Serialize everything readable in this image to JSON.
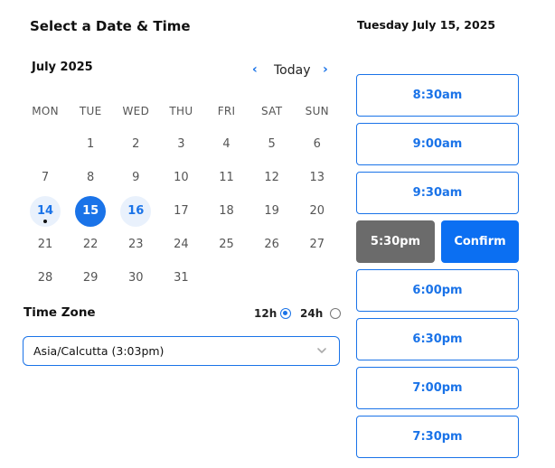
{
  "title": "Select a Date & Time",
  "selected_date_label": "Tuesday July 15, 2025",
  "calendar": {
    "month_label": "July 2025",
    "today_label": "Today",
    "prev_glyph": "‹",
    "next_glyph": "›",
    "weekdays": [
      "MON",
      "TUE",
      "WED",
      "THU",
      "FRI",
      "SAT",
      "SUN"
    ],
    "weeks": [
      [
        "",
        "1",
        "2",
        "3",
        "4",
        "5",
        "6"
      ],
      [
        "7",
        "8",
        "9",
        "10",
        "11",
        "12",
        "13"
      ],
      [
        "14",
        "15",
        "16",
        "17",
        "18",
        "19",
        "20"
      ],
      [
        "21",
        "22",
        "23",
        "24",
        "25",
        "26",
        "27"
      ],
      [
        "28",
        "29",
        "30",
        "31",
        "",
        "",
        ""
      ]
    ],
    "available_days": [
      "14",
      "16"
    ],
    "selected_day": "15",
    "today_day": "14"
  },
  "timezone": {
    "label": "Time Zone",
    "format_12h": "12h",
    "format_24h": "24h",
    "selected_format": "12h",
    "value": "Asia/Calcutta (3:03pm)"
  },
  "slots": {
    "before": [
      "8:30am",
      "9:00am",
      "9:30am"
    ],
    "selected": "5:30pm",
    "confirm_label": "Confirm",
    "after": [
      "6:00pm",
      "6:30pm",
      "7:00pm",
      "7:30pm"
    ]
  },
  "colors": {
    "accent": "#1a73e8",
    "confirm": "#0b6ff2",
    "selected_slot": "#6b6b6b",
    "available_day_bg": "#e9f1fc"
  }
}
